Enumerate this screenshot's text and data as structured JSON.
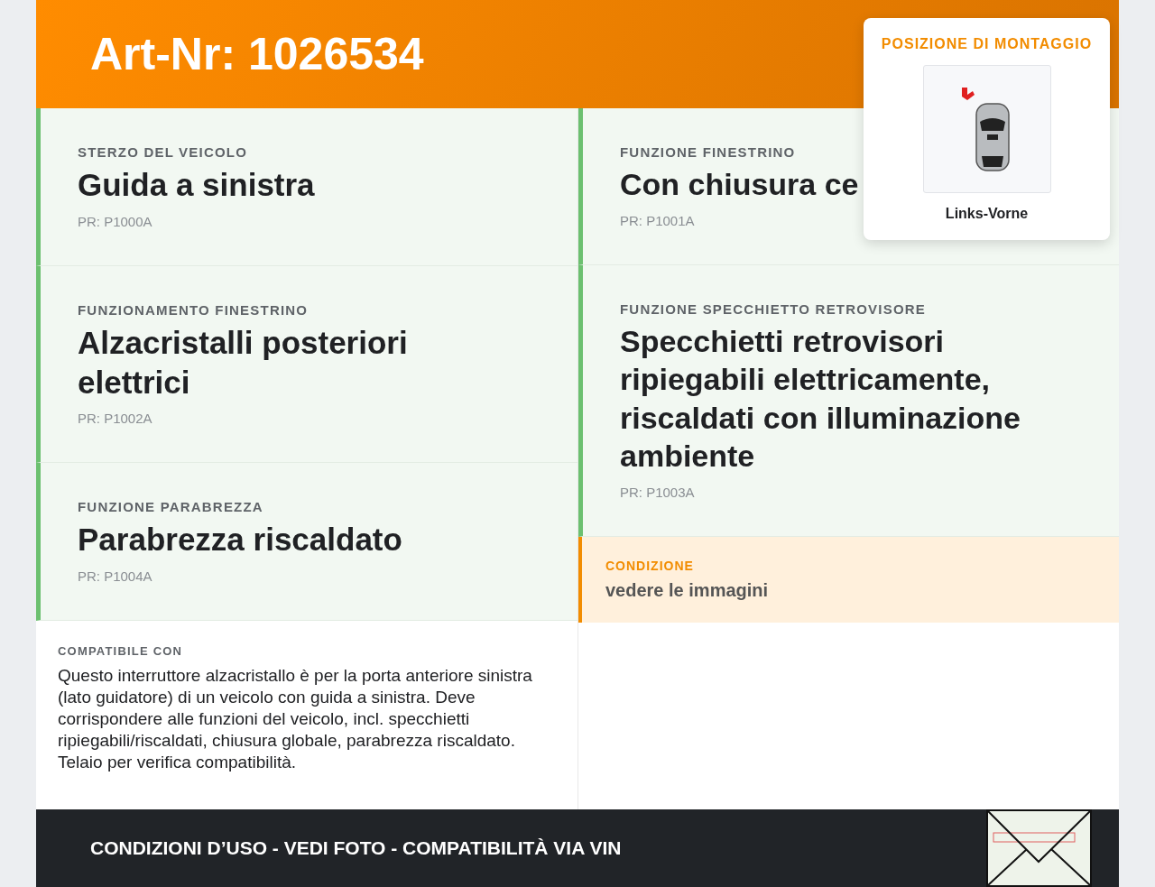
{
  "header": {
    "title": "Art-Nr: 1026534"
  },
  "mounting_position": {
    "title": "POSIZIONE DI MONTAGGIO",
    "caption": "Links-Vorne"
  },
  "left_features": [
    {
      "label": "STERZO DEL VEICOLO",
      "value": "Guida a sinistra",
      "code": "PR: P1000A"
    },
    {
      "label": "FUNZIONAMENTO FINESTRINO",
      "value": "Alzacristalli posteriori elettrici",
      "code": "PR: P1002A"
    },
    {
      "label": "FUNZIONE PARABREZZA",
      "value": "Parabrezza riscaldato",
      "code": "PR: P1004A"
    }
  ],
  "right_features": [
    {
      "label": "FUNZIONE FINESTRINO",
      "value": "Con chiusura ce",
      "code": "PR: P1001A"
    },
    {
      "label": "FUNZIONE SPECCHIETTO RETROVISORE",
      "value": "Specchietti retrovisori ripiegabili elettricamente, riscaldati con illuminazione ambiente",
      "code": "PR: P1003A"
    }
  ],
  "condition": {
    "label": "CONDIZIONE",
    "text": "vedere le immagini"
  },
  "compatibility": {
    "label": "COMPATIBILE CON",
    "text": "Questo interruttore alzacristallo è per la porta anteriore sinistra (lato guidatore) di un veicolo con guida a sinistra. Deve corrispondere alle funzioni del veicolo, incl. specchietti ripiegabili/riscaldati, chiusura globale, parabrezza riscaldato. Telaio per verifica compatibilità."
  },
  "footer": {
    "text": "CONDIZIONI D’USO - VEDI FOTO - COMPATIBILITÀ VIA VIN"
  }
}
